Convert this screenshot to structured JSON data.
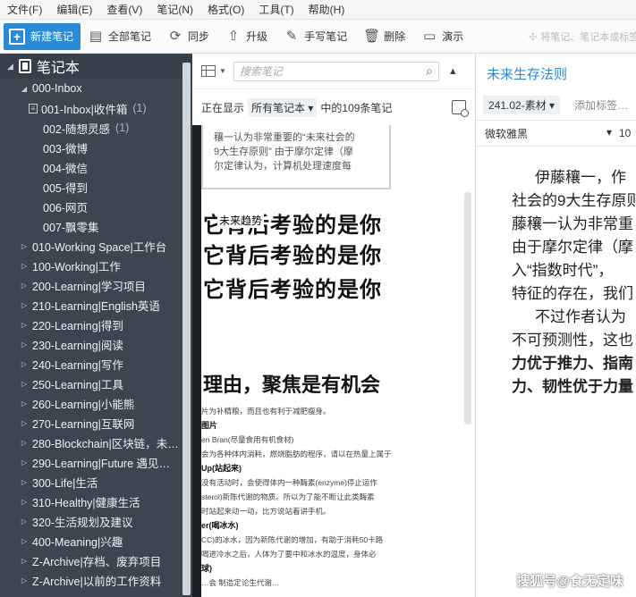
{
  "menu": [
    "文件(F)",
    "编辑(E)",
    "查看(V)",
    "笔记(N)",
    "格式(O)",
    "工具(T)",
    "帮助(H)"
  ],
  "toolbar": {
    "new_note": "新建笔记",
    "all_notes": "全部笔记",
    "sync": "同步",
    "upgrade": "升级",
    "handwrite": "手写笔记",
    "delete": "删除",
    "present": "演示",
    "search_placeholder": "将笔记、笔记本或标签…"
  },
  "sidebar": {
    "title": "笔记本",
    "items": [
      {
        "label": "000-Inbox",
        "count": "",
        "level": 1,
        "arrow": "open"
      },
      {
        "label": "001-Inbox|收件箱",
        "count": "(1)",
        "level": 2,
        "arrow": "box"
      },
      {
        "label": "002-随想灵感",
        "count": "(1)",
        "level": 3,
        "arrow": "none"
      },
      {
        "label": "003-微博",
        "count": "",
        "level": 3,
        "arrow": "none"
      },
      {
        "label": "004-微信",
        "count": "",
        "level": 3,
        "arrow": "none"
      },
      {
        "label": "005-得到",
        "count": "",
        "level": 3,
        "arrow": "none"
      },
      {
        "label": "006-网页",
        "count": "",
        "level": 3,
        "arrow": "none"
      },
      {
        "label": "007-飘零集",
        "count": "",
        "level": 3,
        "arrow": "none"
      },
      {
        "label": "010-Working Space|工作台",
        "count": "",
        "level": 1,
        "arrow": "closed"
      },
      {
        "label": "100-Working|工作",
        "count": "",
        "level": 1,
        "arrow": "closed"
      },
      {
        "label": "200-Learning|学习项目",
        "count": "",
        "level": 1,
        "arrow": "closed"
      },
      {
        "label": "210-Learning|English英语",
        "count": "",
        "level": 1,
        "arrow": "closed"
      },
      {
        "label": "220-Learning|得到",
        "count": "",
        "level": 1,
        "arrow": "closed"
      },
      {
        "label": "230-Learning|阅读",
        "count": "",
        "level": 1,
        "arrow": "closed"
      },
      {
        "label": "240-Learning|写作",
        "count": "",
        "level": 1,
        "arrow": "closed"
      },
      {
        "label": "250-Learning|工具",
        "count": "",
        "level": 1,
        "arrow": "closed"
      },
      {
        "label": "260-Learning|小能熊",
        "count": "",
        "level": 1,
        "arrow": "closed"
      },
      {
        "label": "270-Learning|互联网",
        "count": "",
        "level": 1,
        "arrow": "closed"
      },
      {
        "label": "280-Blockchain|区块链，未…",
        "count": "",
        "level": 1,
        "arrow": "closed"
      },
      {
        "label": "290-Learning|Future 遇见…",
        "count": "",
        "level": 1,
        "arrow": "closed"
      },
      {
        "label": "300-Life|生活",
        "count": "",
        "level": 1,
        "arrow": "closed"
      },
      {
        "label": "310-Healthy|健康生活",
        "count": "",
        "level": 1,
        "arrow": "closed"
      },
      {
        "label": "320-生活规划及建议",
        "count": "",
        "level": 1,
        "arrow": "closed"
      },
      {
        "label": "400-Meaning|兴趣",
        "count": "",
        "level": 1,
        "arrow": "closed"
      },
      {
        "label": "Z-Archive|存档、废弃项目",
        "count": "",
        "level": 1,
        "arrow": "closed"
      },
      {
        "label": "Z-Archive|以前的工作资料",
        "count": "",
        "level": 1,
        "arrow": "closed"
      }
    ]
  },
  "list": {
    "search_placeholder": "搜索笔记",
    "showing": "正在显示",
    "notebook_filter": "所有笔记本",
    "count_text": "中的109条笔记",
    "card_snippet": [
      "穰一认为非常重要的“未来社会的",
      "9大生存原则” 由于摩尔定律（摩",
      "尔定律认为，计算机处理速度每"
    ],
    "overlay_tag": "未来趋势",
    "big_line": "它背后考验的是你",
    "big_line2": "理由，聚焦是有机会",
    "image_label": "图片",
    "small_lines": [
      "片为补精粮，而且也有利于减肥瘦身。",
      "en Bran(尽量食用有机食材)",
      "会为各种体内消耗，燃烧脂肪的程序，请以在热量上属于",
      "Up(站起来)",
      "没有活动时，会使得体内一种酶素(enzyme)停止运作",
      "sterol)新陈代谢的物质。所以为了能不断让此类酶素",
      "时站起来动一动，比方说站着讲手机。",
      "er(喝冰水)",
      "CC)的冰水，因为新陈代谢的增加，有助于消耗50卡路",
      "喝进冷水之后，人体为了要中和冰水的温度，身体必",
      "球)",
      "…会 制造定论生代谢…"
    ]
  },
  "editor": {
    "title": "未来生存法则",
    "notebook_tag": "241.02-素材",
    "add_tag": "添加标签…",
    "font": "微软雅黑",
    "size": "10",
    "body_lines": [
      {
        "t": "伊藤穰一，作",
        "ind": true,
        "b": false
      },
      {
        "t": "社会的9大生存原则",
        "ind": false,
        "b": false
      },
      {
        "t": "藤穰一认为非常重",
        "ind": false,
        "b": false
      },
      {
        "t": " 由于摩尔定律（摩",
        "ind": false,
        "b": false
      },
      {
        "t": "入“指数时代”，",
        "ind": false,
        "b": false
      },
      {
        "t": "特征的存在，我们",
        "ind": false,
        "b": false
      },
      {
        "t": "不过作者认为",
        "ind": true,
        "b": false
      },
      {
        "t": "不可预测性，这也",
        "ind": false,
        "b": false
      },
      {
        "t": "力优于推力、指南",
        "ind": false,
        "b": true
      },
      {
        "t": "力、韧性优于力量",
        "ind": false,
        "b": true
      }
    ]
  },
  "watermark": "搜狐号@食无定味"
}
